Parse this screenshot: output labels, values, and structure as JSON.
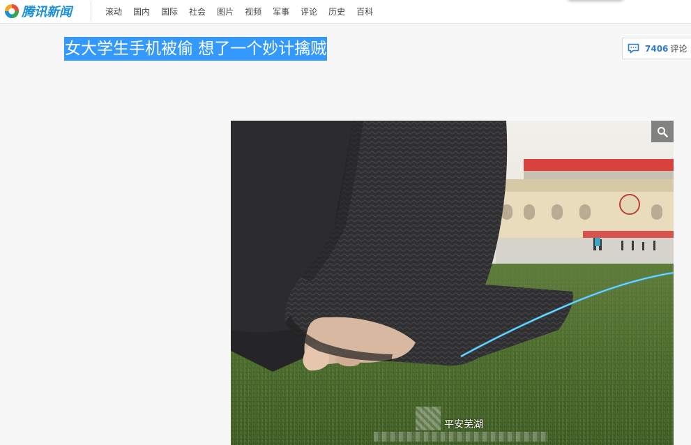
{
  "brand": {
    "name": "腾讯新闻",
    "accent_color": "#1a8fd9"
  },
  "nav": {
    "items": [
      {
        "label": "滚动"
      },
      {
        "label": "国内"
      },
      {
        "label": "国际"
      },
      {
        "label": "社会"
      },
      {
        "label": "图片"
      },
      {
        "label": "视频"
      },
      {
        "label": "军事"
      },
      {
        "label": "评论"
      },
      {
        "label": "历史"
      },
      {
        "label": "百科"
      }
    ]
  },
  "article": {
    "title": "女大学生手机被偷 想了一个妙计擒贼",
    "title_selected": true,
    "selection_color": "#3399ff"
  },
  "comments": {
    "count": "7406",
    "label": "评论",
    "icon": "comment-bubble-icon"
  },
  "photo": {
    "zoom_icon": "magnifier-icon",
    "watermark_text": "平安芜湖"
  }
}
